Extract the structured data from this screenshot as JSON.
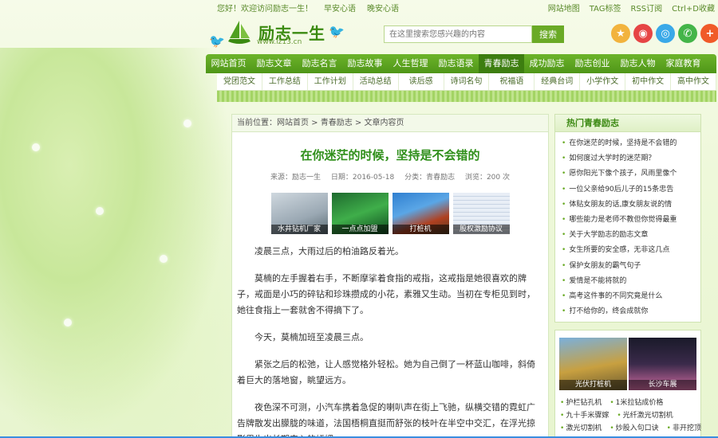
{
  "topbar": {
    "welcome": "您好！欢迎访问励志一生！",
    "link1": "早安心语",
    "link2": "晚安心语",
    "right": [
      "网站地图",
      "TAG标签",
      "RSS订阅",
      "Ctrl+D收藏"
    ]
  },
  "logo": {
    "name": "励志一生",
    "url": "www.lz13.cn"
  },
  "search": {
    "placeholder": "在这里搜索您感兴趣的内容",
    "button": "搜索"
  },
  "nav_primary": [
    "网站首页",
    "励志文章",
    "励志名言",
    "励志故事",
    "人生哲理",
    "励志语录",
    "青春励志",
    "成功励志",
    "励志创业",
    "励志人物",
    "家庭教育"
  ],
  "nav_primary_active": 6,
  "nav_secondary": [
    "党团范文",
    "工作总结",
    "工作计划",
    "活动总结",
    "读后感",
    "诗词名句",
    "祝福语",
    "经典台词",
    "小学作文",
    "初中作文",
    "高中作文"
  ],
  "breadcrumb": "当前位置：网站首页 > 青春励志 > 文章内容页",
  "article": {
    "title": "在你迷茫的时候，坚持是不会错的",
    "source": "来源：励志一生",
    "date": "日期：2016-05-18",
    "category": "分类：青春励志",
    "views": "浏览：200 次",
    "thumbs": [
      "水井钻机厂家",
      "一点点加盟",
      "打桩机",
      "股权激励协议"
    ],
    "paragraphs": [
      "凌晨三点，大雨过后的柏油路反着光。",
      "莫楠的左手握着右手，不断摩挲着食指的戒指，这戒指是她很喜欢的牌子，戒面是小巧的碎钻和珍珠攒成的小花，素雅又生动。当初在专柜见到时，她往食指上一套就舍不得摘下了。",
      "今天，莫楠加班至凌晨三点。",
      "紧张之后的松弛，让人感觉格外轻松。她为自己倒了一杯蓝山咖啡，斜倚着巨大的落地窗，眺望远方。",
      "夜色深不可测，小汽车携着急促的喇叭声在街上飞驰，纵横交错的霓虹广告牌散发出朦胧的味道，法国梧桐直挺而舒张的枝叶在半空中交汇，在浮光掠影里生出长期来入的妩媚。"
    ]
  },
  "sidebar": {
    "hot_title": "热门青春励志",
    "hot": [
      "在你迷茫的时候，坚持是不会错的",
      "如何度过大学时的迷茫期？",
      "愿你阳光下像个孩子，风雨里像个",
      "一位父亲给90后儿子的15条忠告",
      "体贴女朋友的话,康女朋友说的情",
      "哪些能力是老师不教但你觉得最重",
      "关于大学励志的励志文章",
      "女生所要的安全感，无非这几点",
      "保护女朋友的霸气句子",
      "爱情是不能将就的",
      "高考这件事的不同究竟是什么",
      "打不给你的，终会成就你"
    ],
    "ads": [
      "光伏打桩机",
      "长沙车展"
    ],
    "ad_links": [
      [
        "护栏钻孔机",
        "1米拉钻成价格"
      ],
      [
        "九十手米骤嫁",
        "光纤激光切割机"
      ],
      [
        "激光切割机",
        "炒股入句口诀",
        "非开挖顶"
      ]
    ]
  },
  "colors": {
    "brand_green": "#4f9618",
    "title_green": "#2f8f1a",
    "accent": "#6aaa26"
  }
}
